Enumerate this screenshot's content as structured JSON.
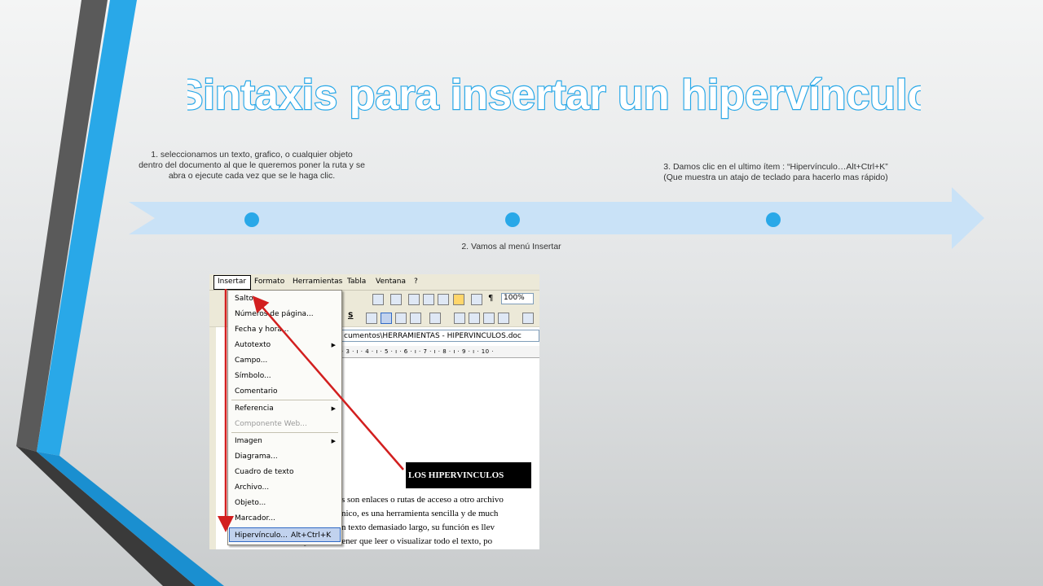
{
  "title": "Sintaxis para insertar un hipervínculo",
  "steps": {
    "s1": "1. seleccionamos un texto, grafico,  o cualquier objeto dentro del documento al que le queremos poner la ruta y se abra  o ejecute cada vez que se le haga clic.",
    "s2": "2. Vamos al menú Insertar",
    "s3": "3. Damos clic en el ultimo ítem : “Hipervínculo…Alt+Ctrl+K” (Que muestra un atajo de teclado para hacerlo mas rápido)"
  },
  "colors": {
    "accent": "#29a8e8",
    "arrow": "#c9e2f7",
    "title": "#29a8e8",
    "red": "#d21f1f"
  },
  "screenshot": {
    "menubar": [
      "Insertar",
      "Formato",
      "Herramientas",
      "Tabla",
      "Ventana",
      "?"
    ],
    "zoom": "100%",
    "path": "cumentos\\HERRAMIENTAS - HIPERVINCULOS.doc",
    "ruler": "· 3 · ı · 4 · ı · 5 · ı · 6 · ı · 7 · ı · 8 · ı · 9 · ı · 10 ·",
    "menu_items": [
      {
        "label": "Salto...",
        "submenu": false,
        "disabled": false
      },
      {
        "label": "Números de página...",
        "submenu": false,
        "disabled": false
      },
      {
        "label": "Fecha y hora...",
        "submenu": false,
        "disabled": false
      },
      {
        "label": "Autotexto",
        "submenu": true,
        "disabled": false
      },
      {
        "label": "Campo...",
        "submenu": false,
        "disabled": false
      },
      {
        "label": "Símbolo...",
        "submenu": false,
        "disabled": false
      },
      {
        "label": "Comentario",
        "submenu": false,
        "disabled": false
      },
      {
        "label": "Referencia",
        "submenu": true,
        "disabled": false
      },
      {
        "label": "Componente Web...",
        "submenu": false,
        "disabled": true
      },
      {
        "label": "Imagen",
        "submenu": true,
        "disabled": false
      },
      {
        "label": "Diagrama...",
        "submenu": false,
        "disabled": false
      },
      {
        "label": "Cuadro de texto",
        "submenu": false,
        "disabled": false
      },
      {
        "label": "Archivo...",
        "submenu": false,
        "disabled": false
      },
      {
        "label": "Objeto...",
        "submenu": false,
        "disabled": false
      },
      {
        "label": "Marcador...",
        "submenu": false,
        "disabled": false
      },
      {
        "label": "Hipervínculo...",
        "submenu": false,
        "disabled": false,
        "shortcut": "Alt+Ctrl+K"
      }
    ],
    "doc_heading": "LOS HIPERVINCULOS",
    "doc_lines": [
      "s son enlaces o rutas de acceso a otro archivo",
      "nico, es una herramienta sencilla y de much",
      "n texto demasiado largo, su función es llev",
      "hasta otro punto sin tener que leer o visualizar todo el texto, po"
    ]
  }
}
